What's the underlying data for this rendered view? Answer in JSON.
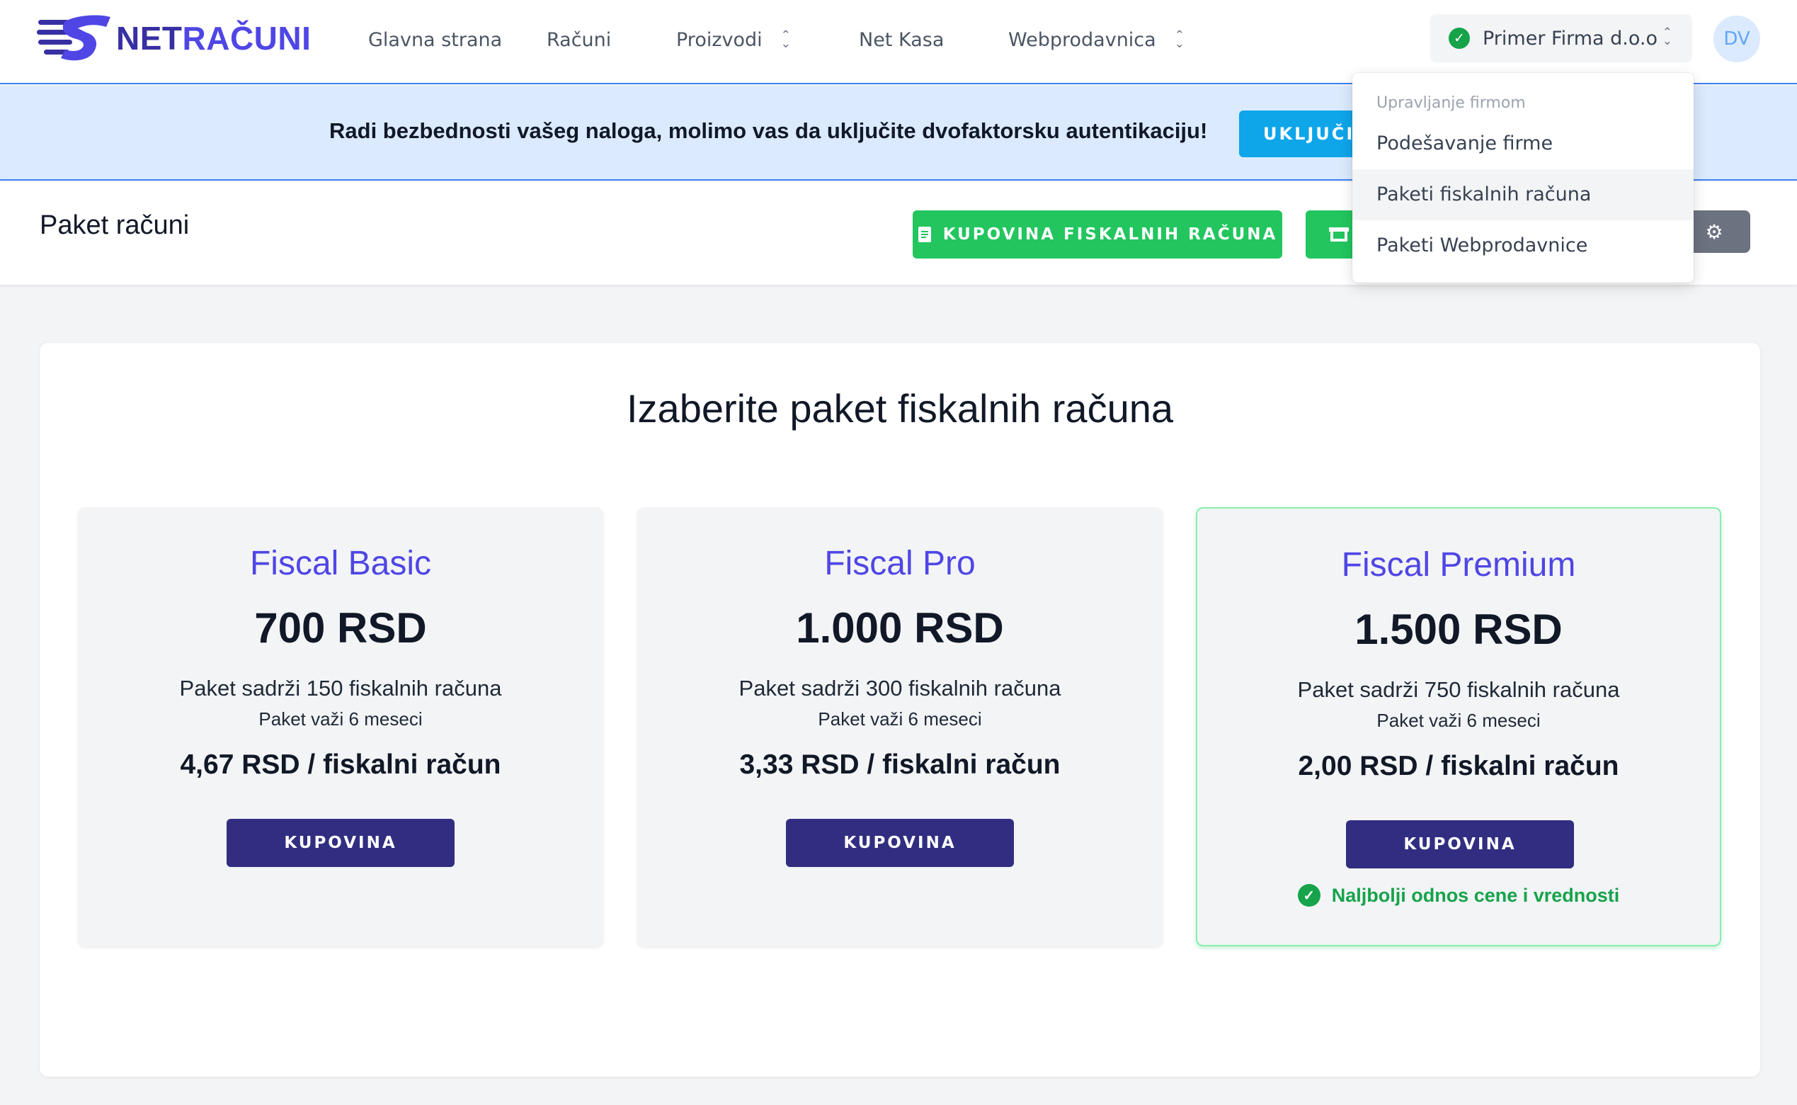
{
  "nav": {
    "brand_prefix": "NET",
    "brand_suffix": "RAČUNI",
    "items": [
      {
        "label": "Glavna strana"
      },
      {
        "label": "Računi"
      },
      {
        "label": "Proizvodi"
      },
      {
        "label": "Net Kasa"
      },
      {
        "label": "Webprodavnica"
      }
    ],
    "company": "Primer Firma d.o.o",
    "avatar_initials": "DV"
  },
  "banner": {
    "text": "Radi bezbednosti vašeg naloga, molimo vas da uključite dvofaktorsku autentikaciju!",
    "button_label": "UKLJUČI"
  },
  "header": {
    "title": "Paket računi",
    "buy_fiscal_label": "KUPOVINA FISKALNIH RAČUNA",
    "buy_web_label": ""
  },
  "dropdown": {
    "header": "Upravljanje firmom",
    "items": [
      {
        "label": "Podešavanje firme"
      },
      {
        "label": "Paketi fiskalnih računa"
      },
      {
        "label": "Paketi Webprodavnice"
      }
    ]
  },
  "main": {
    "title": "Izaberite paket fiskalnih računa",
    "packages": [
      {
        "name": "Fiscal Basic",
        "price": "700 RSD",
        "contains": "Paket sadrži 150 fiskalnih računa",
        "valid": "Paket važi 6 meseci",
        "unit_price": "4,67 RSD / fiskalni račun",
        "button": "KUPOVINA"
      },
      {
        "name": "Fiscal Pro",
        "price": "1.000 RSD",
        "contains": "Paket sadrži 300 fiskalnih računa",
        "valid": "Paket važi 6 meseci",
        "unit_price": "3,33 RSD / fiskalni račun",
        "button": "KUPOVINA"
      },
      {
        "name": "Fiscal Premium",
        "price": "1.500 RSD",
        "contains": "Paket sadrži 750 fiskalnih računa",
        "valid": "Paket važi 6 meseci",
        "unit_price": "2,00 RSD / fiskalni račun",
        "button": "KUPOVINA",
        "badge": "Naljbolji odnos cene i vrednosti"
      }
    ]
  },
  "colors": {
    "primary_indigo": "#312e81",
    "accent_indigo": "#4f46e5",
    "success_green": "#22c55e",
    "info_blue": "#0ea5e9",
    "banner_bg": "#dbeafe"
  },
  "icons": {
    "company_status": "check-circle-icon",
    "buy_fiscal": "document-icon",
    "buy_web": "store-icon",
    "settings": "gear-icon",
    "best_value": "check-circle-icon"
  }
}
